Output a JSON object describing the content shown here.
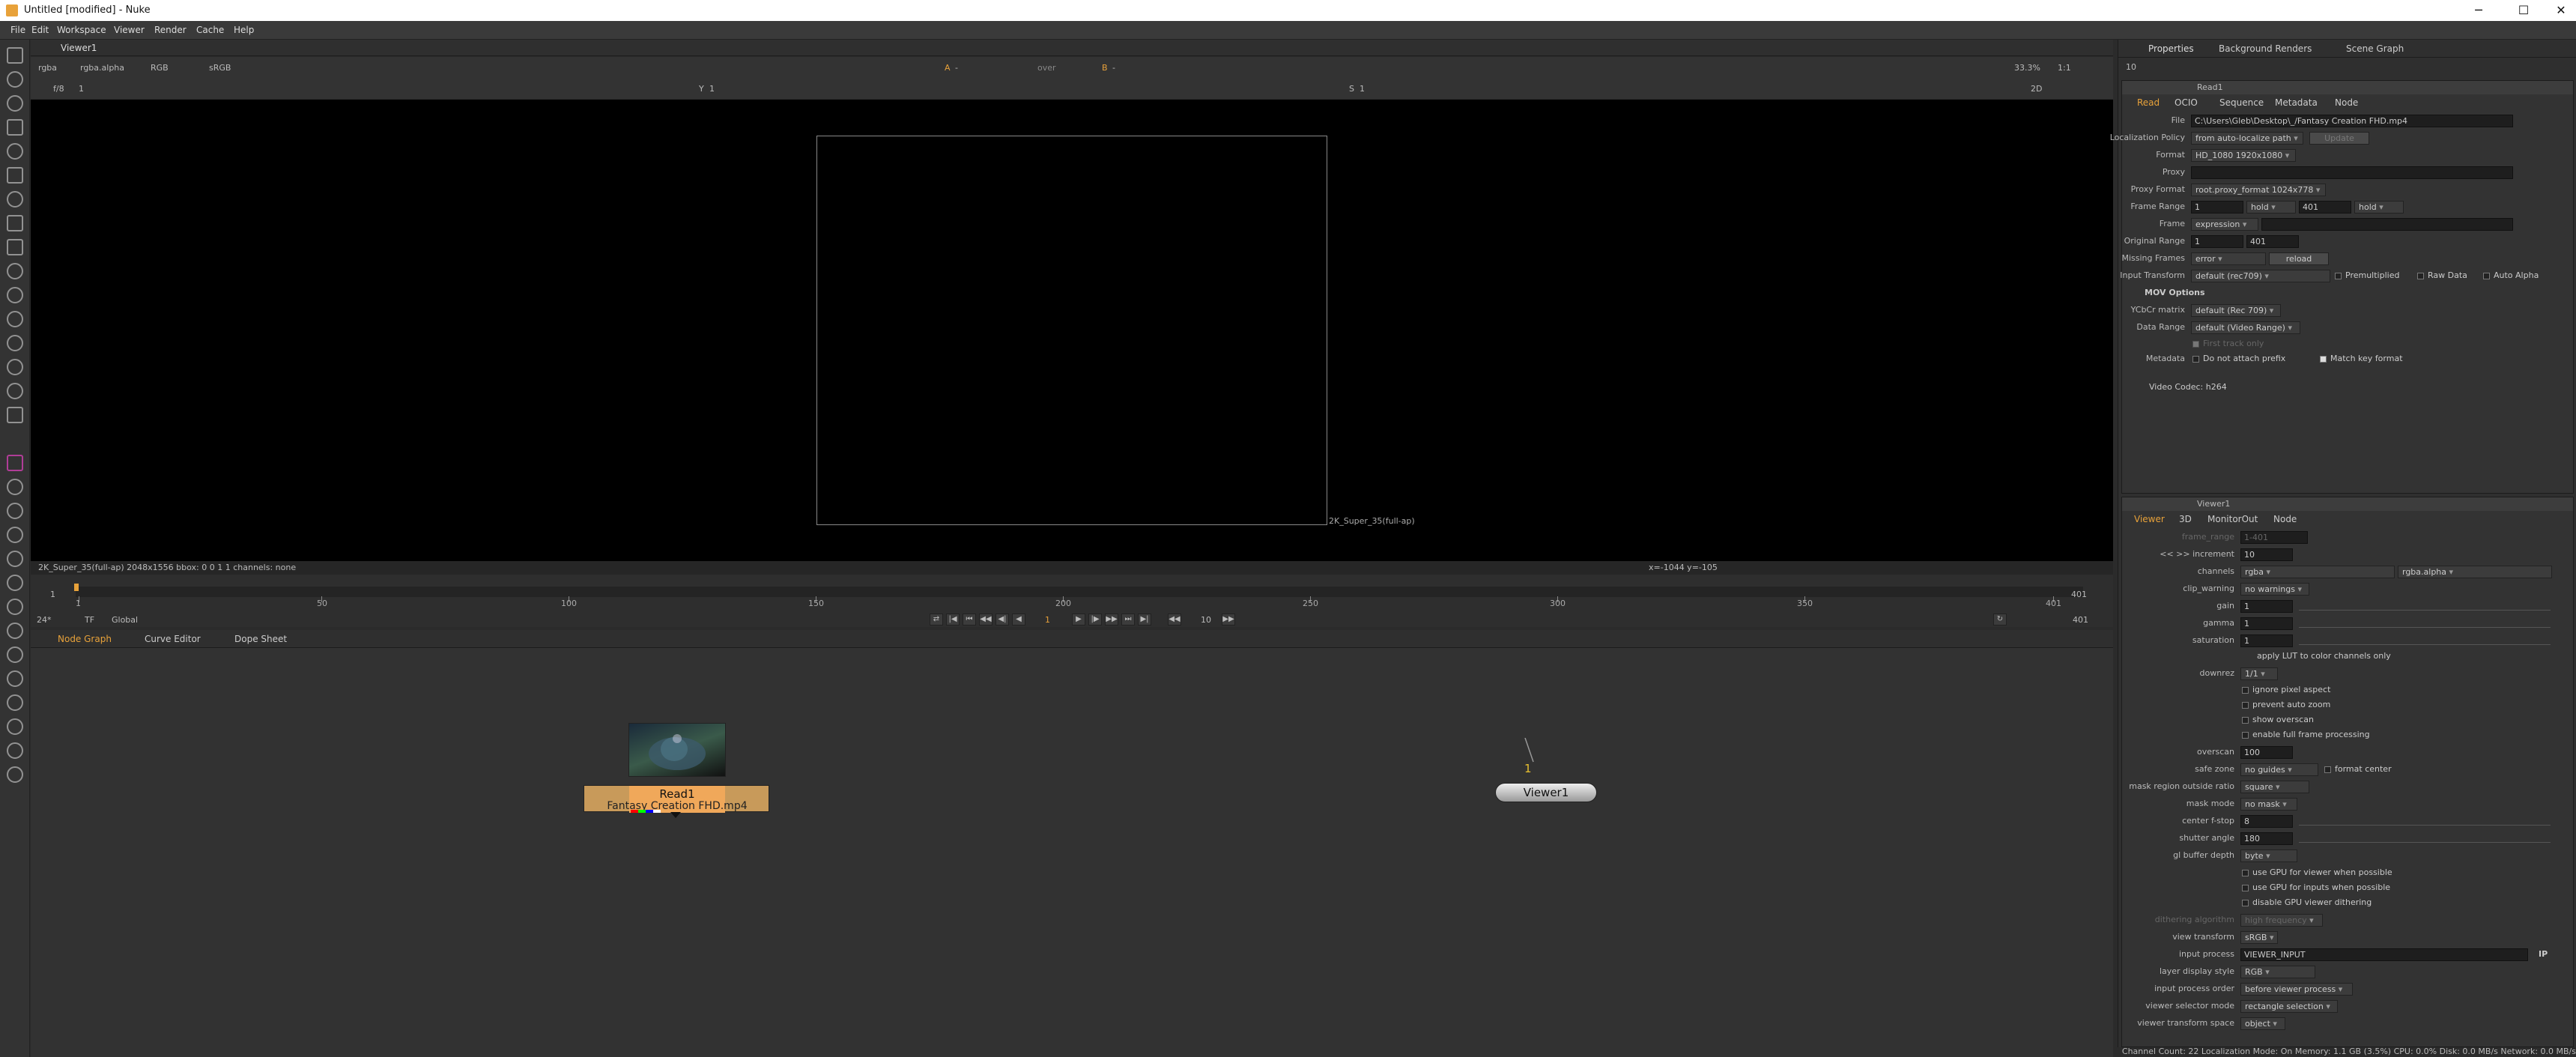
{
  "window": {
    "title": "Untitled [modified] - Nuke",
    "minimize": "─",
    "maximize": "☐",
    "close": "✕"
  },
  "menu": [
    "File",
    "Edit",
    "Workspace",
    "Viewer",
    "Render",
    "Cache",
    "Help"
  ],
  "viewer_tab": {
    "label": "Viewer1"
  },
  "viewer_toolbar": {
    "channels": "rgba",
    "alpha": "rgba.alpha",
    "display": "RGB",
    "lut": "sRGB",
    "input_a": "A",
    "input_a_val": "-",
    "blend": "over",
    "input_b": "B",
    "input_b_val": "-",
    "zoom": "33.3%",
    "ratio": "1:1",
    "fstop_label": "f/8",
    "frame_label": "1",
    "y_label": "Y",
    "y_value": "1",
    "s_label": "S",
    "s_value": "1",
    "mode_2d": "2D"
  },
  "viewer": {
    "format_label": "2K_Super_35(full-ap)",
    "info": "2K_Super_35(full-ap) 2048x1556  bbox: 0 0 1 1 channels: none",
    "coords": "x=-1044 y=-105"
  },
  "timeline": {
    "ticks": [
      "1",
      "50",
      "100",
      "150",
      "200",
      "250",
      "300",
      "350",
      "401"
    ],
    "start": "1",
    "end": "401",
    "end2": "401",
    "end3": "401",
    "fps": "24*",
    "tf": "TF",
    "global": "Global",
    "current_frame": "1",
    "increment": "10"
  },
  "graph_tabs": [
    "Node Graph",
    "Curve Editor",
    "Dope Sheet"
  ],
  "nodes": {
    "read": {
      "name": "Read1",
      "file": "Fantasy Creation FHD.mp4"
    },
    "viewer": {
      "name": "Viewer1",
      "input": "1"
    }
  },
  "right_tabs": [
    "Properties",
    "Background Renders",
    "Scene Graph"
  ],
  "props_max": "10",
  "read_panel": {
    "title": "Read1",
    "tabs": [
      "Read",
      "OCIO",
      "Sequence",
      "Metadata",
      "Node"
    ],
    "file_label": "File",
    "file": "C:\\Users\\Gleb\\Desktop\\_/Fantasy Creation FHD.mp4",
    "loc_label": "Localization Policy",
    "loc": "from auto-localize path",
    "loc_btn": "Update",
    "format_label": "Format",
    "format": "HD_1080 1920x1080",
    "proxy_label": "Proxy",
    "proxyfmt_label": "Proxy Format",
    "proxyfmt": "root.proxy_format 1024x778",
    "range_label": "Frame Range",
    "range_start": "1",
    "range_hold1": "hold",
    "range_end": "401",
    "range_hold2": "hold",
    "frame_label": "Frame",
    "frame_mode": "expression",
    "orig_label": "Original Range",
    "orig_start": "1",
    "orig_end": "401",
    "missing_label": "Missing Frames",
    "missing": "error",
    "reload": "reload",
    "input_label": "Input Transform",
    "input": "default (rec709)",
    "premult": "Premultiplied",
    "raw": "Raw Data",
    "auto_alpha": "Auto Alpha",
    "mov_header": "MOV Options",
    "ycbcr_label": "YCbCr matrix",
    "ycbcr": "default (Rec 709)",
    "datarange_label": "Data Range",
    "datarange": "default (Video Range)",
    "first_track": "First track only",
    "metadata_label": "Metadata",
    "no_prefix": "Do not attach prefix",
    "match_key": "Match key format",
    "codec": "Video Codec: h264"
  },
  "viewer_panel": {
    "title": "Viewer1",
    "tabs": [
      "Viewer",
      "3D",
      "MonitorOut",
      "Node"
    ],
    "frame_range_label": "frame_range",
    "frame_range": "1-401",
    "increment_label": "<< >> increment",
    "increment": "10",
    "channels_label": "channels",
    "channels": "rgba",
    "channels_alpha": "rgba.alpha",
    "clip_label": "clip_warning",
    "clip": "no warnings",
    "gain_label": "gain",
    "gain": "1",
    "gamma_label": "gamma",
    "gamma": "1",
    "sat_label": "saturation",
    "sat": "1",
    "apply_lut": "apply LUT to color channels only",
    "downrez_label": "downrez",
    "downrez": "1/1",
    "ignore_pa": "ignore pixel aspect",
    "prevent_zoom": "prevent auto zoom",
    "show_overscan": "show overscan",
    "full_frame": "enable full frame processing",
    "overscan_label": "overscan",
    "overscan": "100",
    "safe_label": "safe zone",
    "safe": "no guides",
    "format_center": "format center",
    "mask_region_label": "mask region outside ratio",
    "mask_region": "square",
    "mask_mode_label": "mask mode",
    "mask_mode": "no mask",
    "fstop_label": "center f-stop",
    "fstop": "8",
    "shutter_label": "shutter angle",
    "shutter": "180",
    "gl_label": "gl buffer depth",
    "gl": "byte",
    "gpu_viewer": "use GPU for viewer when possible",
    "gpu_inputs": "use GPU for inputs when possible",
    "dither": "disable GPU viewer dithering",
    "dither_algo_label": "dithering algorithm",
    "dither_algo": "high frequency",
    "vt_label": "view transform",
    "vt": "sRGB",
    "ip_label": "input process",
    "ip": "VIEWER_INPUT",
    "ip_btn": "IP",
    "lds_label": "layer display style",
    "lds": "RGB",
    "ipo_label": "input process order",
    "ipo": "before viewer process",
    "vsm_label": "viewer selector mode",
    "vsm": "rectangle selection",
    "vts_label": "viewer transform space",
    "vts": "object"
  },
  "status": "Channel Count: 22  Localization Mode: On  Memory: 1.1 GB (3.5%)  CPU: 0.0%  Disk: 0.0 MB/s  Network: 0.0 MB/s"
}
